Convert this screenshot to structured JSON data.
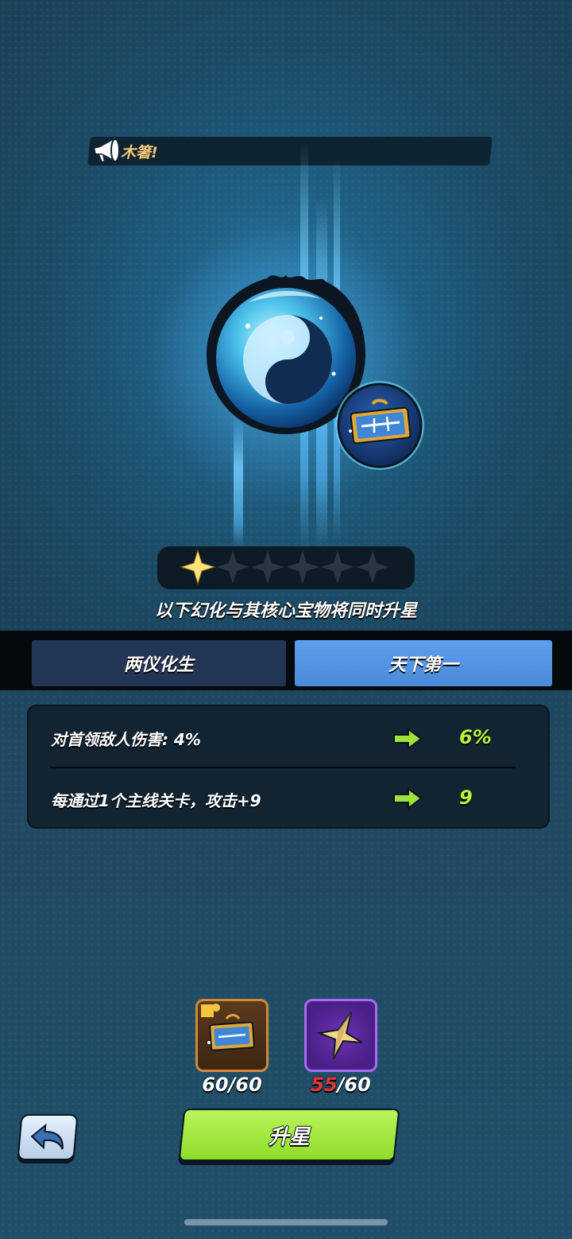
{
  "announcement": {
    "text": "木箸!"
  },
  "treasure": {
    "main_icon": "yin-yang-orb-icon",
    "core_icon": "tianxia-diyi-plaque-icon"
  },
  "stars": {
    "filled": 1,
    "total": 6
  },
  "caption": "以下幻化与其核心宝物将同时升星",
  "tabs": [
    {
      "label": "两仪化生",
      "active": false
    },
    {
      "label": "天下第一",
      "active": true
    }
  ],
  "stats": [
    {
      "label": "对首领敌人伤害: 4%",
      "next": "6%"
    },
    {
      "label": "每通过1个主线关卡，攻击+9",
      "next": "9"
    }
  ],
  "materials": [
    {
      "icon": "plaque-fragment-icon",
      "have": "60",
      "need": "60",
      "count_text": "/60"
    },
    {
      "icon": "gold-star-icon",
      "have": "55",
      "need": "60",
      "count_text": "/60"
    }
  ],
  "buttons": {
    "back_icon": "back-arrow-icon",
    "upgrade_label": "升星"
  },
  "colors": {
    "accent_green": "#b8f23a",
    "tab_active": "#4a8ad8",
    "tab_inactive": "#223554",
    "shortage_red": "#e0383a"
  }
}
